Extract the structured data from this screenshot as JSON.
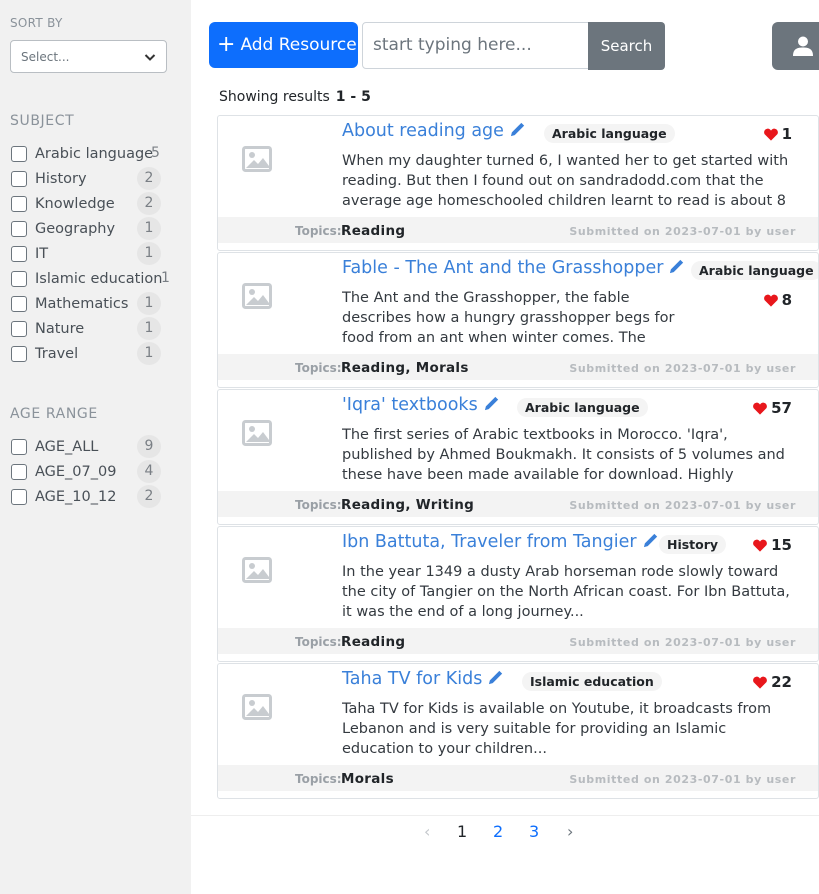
{
  "sidebar": {
    "sort_heading": "SORT BY",
    "sort_placeholder": "Select...",
    "subject_heading": "SUBJECT",
    "subjects": [
      {
        "label": "Arabic language",
        "count": "5"
      },
      {
        "label": "History",
        "count": "2"
      },
      {
        "label": "Knowledge",
        "count": "2"
      },
      {
        "label": "Geography",
        "count": "1"
      },
      {
        "label": "IT",
        "count": "1"
      },
      {
        "label": "Islamic education",
        "count": "1"
      },
      {
        "label": "Mathematics",
        "count": "1"
      },
      {
        "label": "Nature",
        "count": "1"
      },
      {
        "label": "Travel",
        "count": "1"
      }
    ],
    "age_heading": "AGE RANGE",
    "ages": [
      {
        "label": "AGE_ALL",
        "count": "9"
      },
      {
        "label": "AGE_07_09",
        "count": "4"
      },
      {
        "label": "AGE_10_12",
        "count": "2"
      }
    ]
  },
  "toolbar": {
    "add_label": "Add Resource",
    "search_placeholder": "start typing here...",
    "search_label": "Search"
  },
  "results": {
    "showing_label": "Showing results",
    "range": "1 - 5"
  },
  "cards": [
    {
      "title": "About reading age",
      "tag": "Arabic language",
      "likes": "1",
      "desc": "When my daughter turned 6, I wanted her to get started with reading. But then I found out on sandradodd.com that the average age homeschooled children learnt to read is about 8",
      "topics_label": "Topics:",
      "topics": "Reading",
      "submitted": "Submitted on 2023-07-01 by user"
    },
    {
      "title": "Fable - The Ant and the Grasshopper",
      "tag": "Arabic language",
      "likes": "8",
      "desc": "The Ant and the Grasshopper, the fable describes how a hungry grasshopper begs for food from an ant when winter comes. The situation sums up moral lessons about the virtues of hard work",
      "topics_label": "Topics:",
      "topics": "Reading, Morals",
      "submitted": "Submitted on 2023-07-01 by user"
    },
    {
      "title": "'Iqra' textbooks",
      "tag": "Arabic language",
      "likes": "57",
      "desc": "The first series of Arabic textbooks in Morocco. 'Iqra', published by Ahmed Boukmakh. It consists of 5 volumes and these have been made available for download. Highly recommended for beginner learners",
      "topics_label": "Topics:",
      "topics": "Reading, Writing",
      "submitted": "Submitted on 2023-07-01 by user"
    },
    {
      "title": "Ibn Battuta, Traveler from Tangier",
      "tag": "History",
      "likes": "15",
      "desc": "In the year 1349 a dusty Arab horseman rode slowly toward the city of Tangier on the North African coast. For Ibn Battuta, it was the end of a long journey...",
      "topics_label": "Topics:",
      "topics": "Reading",
      "submitted": "Submitted on 2023-07-01 by user"
    },
    {
      "title": "Taha TV for Kids",
      "tag": "Islamic education",
      "likes": "22",
      "desc": "Taha TV for Kids is available on Youtube, it broadcasts from Lebanon and is very suitable for providing an Islamic education to your children...",
      "topics_label": "Topics:",
      "topics": "Morals",
      "submitted": "Submitted on 2023-07-01 by user"
    }
  ],
  "pagination": {
    "prev": "‹",
    "pages": [
      "1",
      "2",
      "3"
    ],
    "next": "›",
    "current": "1"
  },
  "colors": {
    "primary": "#0d6efd",
    "secondary": "#6c757d",
    "heart": "#e8171c",
    "link": "#3a80d9"
  }
}
